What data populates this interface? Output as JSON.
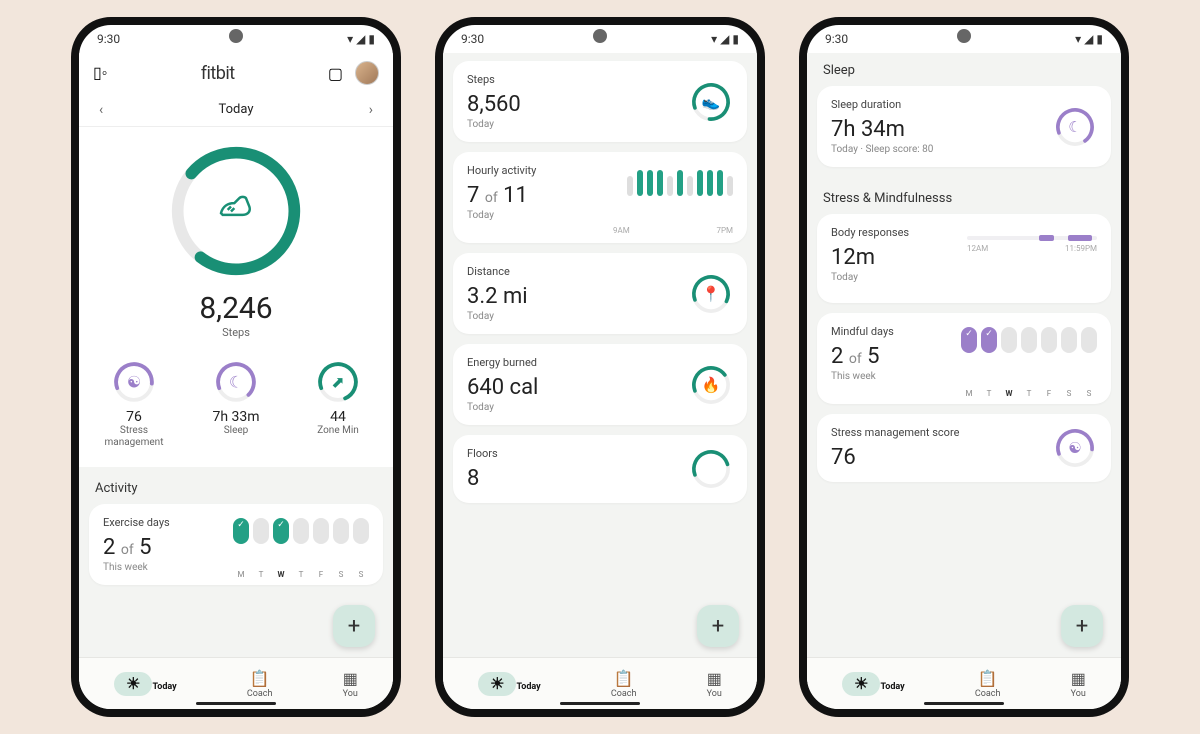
{
  "status": {
    "time": "9:30"
  },
  "brand": "fitbit",
  "day": "Today",
  "hero": {
    "steps": "8,246",
    "label": "Steps"
  },
  "metrics": {
    "stress": {
      "value": "76",
      "label": "Stress\nmanagement"
    },
    "sleep": {
      "value": "7h 33m",
      "label": "Sleep"
    },
    "zone": {
      "value": "44",
      "label": "Zone Min"
    }
  },
  "activity_section": "Activity",
  "exercise_days": {
    "title": "Exercise days",
    "value_a": "2",
    "of": "of",
    "value_b": "5",
    "sub": "This week",
    "days": [
      "M",
      "T",
      "W",
      "T",
      "F",
      "S",
      "S"
    ]
  },
  "cards": {
    "steps": {
      "title": "Steps",
      "value": "8,560",
      "sub": "Today"
    },
    "hourly": {
      "title": "Hourly activity",
      "value_a": "7",
      "of": "of",
      "value_b": "11",
      "sub": "Today",
      "label_left": "9AM",
      "label_right": "7PM"
    },
    "distance": {
      "title": "Distance",
      "value": "3.2 mi",
      "sub": "Today"
    },
    "energy": {
      "title": "Energy burned",
      "value": "640 cal",
      "sub": "Today"
    },
    "floors": {
      "title": "Floors",
      "value": "8"
    }
  },
  "sleep_section": "Sleep",
  "sleep_card": {
    "title": "Sleep duration",
    "value": "7h 34m",
    "sub": "Today · Sleep score: 80"
  },
  "stress_section": "Stress & Mindfulnesss",
  "body_resp": {
    "title": "Body responses",
    "value": "12m",
    "sub": "Today",
    "label_left": "12AM",
    "label_right": "11:59PM"
  },
  "mindful": {
    "title": "Mindful days",
    "value_a": "2",
    "of": "of",
    "value_b": "5",
    "sub": "This week",
    "days": [
      "M",
      "T",
      "W",
      "T",
      "F",
      "S",
      "S"
    ]
  },
  "stress_score": {
    "title": "Stress management score",
    "value": "76"
  },
  "nav": {
    "today": "Today",
    "coach": "Coach",
    "you": "You"
  }
}
